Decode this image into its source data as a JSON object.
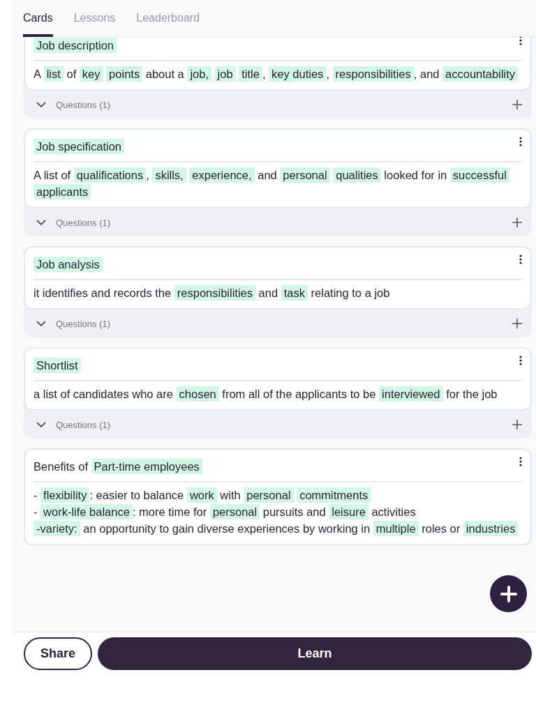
{
  "tabs": [
    {
      "label": "Cards",
      "selected": true
    },
    {
      "label": "Lessons",
      "selected": false
    },
    {
      "label": "Leaderboard",
      "selected": false
    }
  ],
  "cards": [
    {
      "front": [
        [
          {
            "text": "Job description",
            "highlight": true
          }
        ]
      ],
      "back": [
        [
          {
            "text": "A ",
            "highlight": false
          },
          {
            "text": "list",
            "highlight": true
          },
          {
            "text": " of ",
            "highlight": false
          },
          {
            "text": "key ",
            "highlight": true
          },
          {
            "text": "points",
            "highlight": true
          },
          {
            "text": " about a ",
            "highlight": false
          },
          {
            "text": "job, ",
            "highlight": true
          },
          {
            "text": "job ",
            "highlight": true
          },
          {
            "text": "title",
            "highlight": true
          },
          {
            "text": ", ",
            "highlight": false
          },
          {
            "text": "key duties",
            "highlight": true
          },
          {
            "text": ", ",
            "highlight": false
          },
          {
            "text": "responsibilities",
            "highlight": true
          },
          {
            "text": ", and ",
            "highlight": false
          },
          {
            "text": "accountability",
            "highlight": true
          }
        ]
      ],
      "questions": "Questions (1)",
      "expanded": false
    },
    {
      "front": [
        [
          {
            "text": "Job specification",
            "highlight": true
          }
        ]
      ],
      "back": [
        [
          {
            "text": "A list of ",
            "highlight": false
          },
          {
            "text": "qualifications",
            "highlight": true
          },
          {
            "text": ", ",
            "highlight": false
          },
          {
            "text": "skills, ",
            "highlight": true
          },
          {
            "text": "experience,",
            "highlight": true
          },
          {
            "text": " and ",
            "highlight": false
          },
          {
            "text": "personal ",
            "highlight": true
          },
          {
            "text": "qualities",
            "highlight": true
          },
          {
            "text": " looked for in ",
            "highlight": false
          },
          {
            "text": "successful ",
            "highlight": true
          },
          {
            "text": "applicants",
            "highlight": true
          }
        ]
      ],
      "questions": "Questions (1)",
      "expanded": false
    },
    {
      "front": [
        [
          {
            "text": "Job analysis",
            "highlight": true
          }
        ]
      ],
      "back": [
        [
          {
            "text": "it identifies and records the ",
            "highlight": false
          },
          {
            "text": "responsibilities",
            "highlight": true
          },
          {
            "text": " and ",
            "highlight": false
          },
          {
            "text": "task",
            "highlight": true
          },
          {
            "text": " relating to a job",
            "highlight": false
          }
        ]
      ],
      "questions": "Questions (1)",
      "expanded": false
    },
    {
      "front": [
        [
          {
            "text": "Shortlist",
            "highlight": true
          }
        ]
      ],
      "back": [
        [
          {
            "text": "a list of candidates who are ",
            "highlight": false
          },
          {
            "text": "chosen",
            "highlight": true
          },
          {
            "text": " from all of the applicants to be ",
            "highlight": false
          },
          {
            "text": "interviewed",
            "highlight": true
          },
          {
            "text": " for the job",
            "highlight": false
          }
        ]
      ],
      "questions": "Questions (1)",
      "expanded": false
    },
    {
      "front": [
        [
          {
            "text": "Benefits of ",
            "highlight": false
          },
          {
            "text": "Part-time employees",
            "highlight": true
          }
        ]
      ],
      "back": [
        [
          {
            "text": "- ",
            "highlight": false
          },
          {
            "text": "flexibility",
            "highlight": true
          },
          {
            "text": ": easier to balance ",
            "highlight": false
          },
          {
            "text": "work",
            "highlight": true
          },
          {
            "text": " with ",
            "highlight": false
          },
          {
            "text": "personal ",
            "highlight": true
          },
          {
            "text": "commitments",
            "highlight": true
          }
        ],
        [
          {
            "text": "- ",
            "highlight": false
          },
          {
            "text": "work-life balance",
            "highlight": true
          },
          {
            "text": ": more time for ",
            "highlight": false
          },
          {
            "text": "personal",
            "highlight": true
          },
          {
            "text": " pursuits and ",
            "highlight": false
          },
          {
            "text": "leisure",
            "highlight": true
          },
          {
            "text": " activities",
            "highlight": false
          }
        ],
        [
          {
            "text": "-variety:",
            "highlight": true
          },
          {
            "text": " an opportunity to gain diverse experiences by working in ",
            "highlight": false
          },
          {
            "text": "multiple",
            "highlight": true
          },
          {
            "text": " roles or ",
            "highlight": false
          },
          {
            "text": "industries",
            "highlight": true
          }
        ]
      ]
    }
  ],
  "buttons": {
    "share": "Share",
    "learn": "Learn"
  }
}
